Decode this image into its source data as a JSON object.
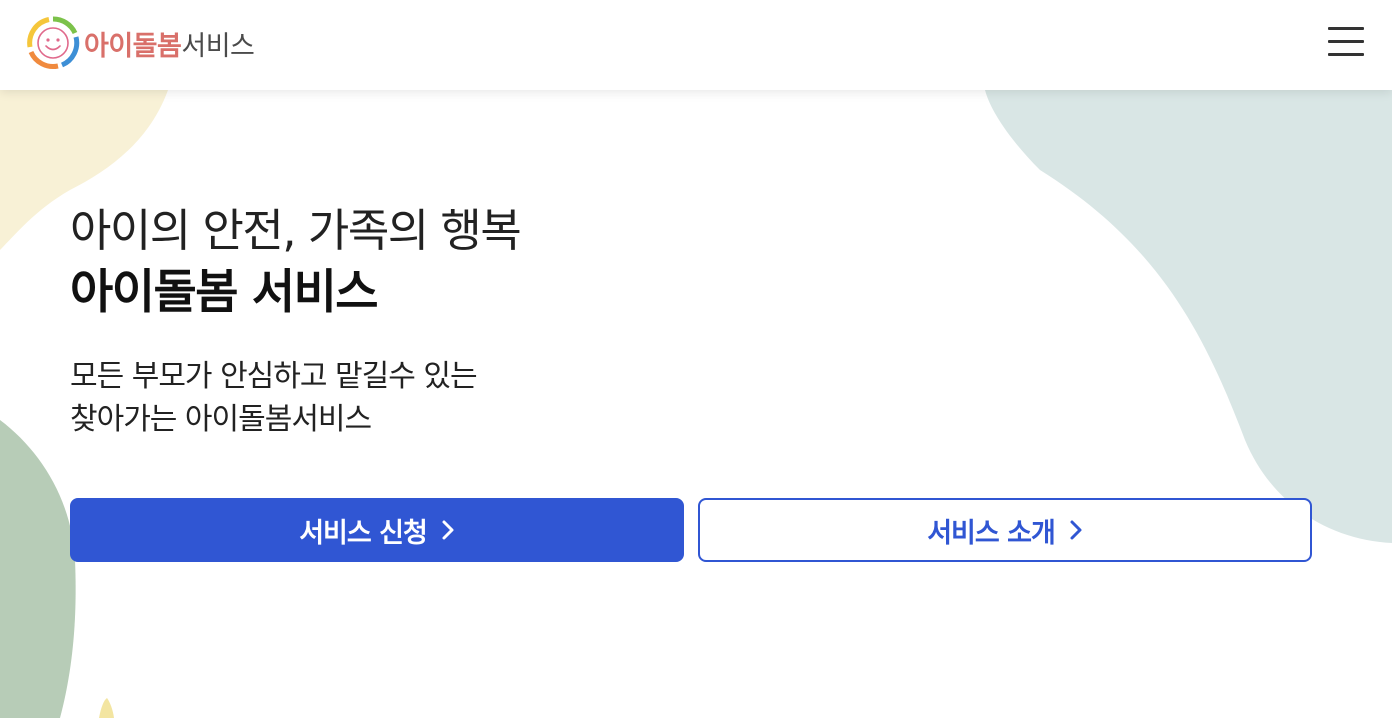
{
  "colors": {
    "accent": "#3056d3",
    "brand_text": "#d9706a",
    "blob_yellow": "#f8f1d6",
    "blob_teal": "#d9e6e5",
    "blob_green": "#b7ccb7"
  },
  "header": {
    "logo": {
      "icon": "smiley-ring-logo-icon",
      "brand_text": "아이돌봄",
      "service_text": "서비스"
    },
    "menu_icon": "hamburger-menu-icon"
  },
  "hero": {
    "line1": "아이의 안전, 가족의 행복",
    "line2": "아이돌봄 서비스",
    "desc_line1": "모든 부모가 안심하고 맡길수 있는",
    "desc_line2": "찾아가는 아이돌봄서비스"
  },
  "buttons": {
    "apply_label": "서비스 신청",
    "intro_label": "서비스 소개",
    "arrow_icon": "chevron-right-icon"
  }
}
